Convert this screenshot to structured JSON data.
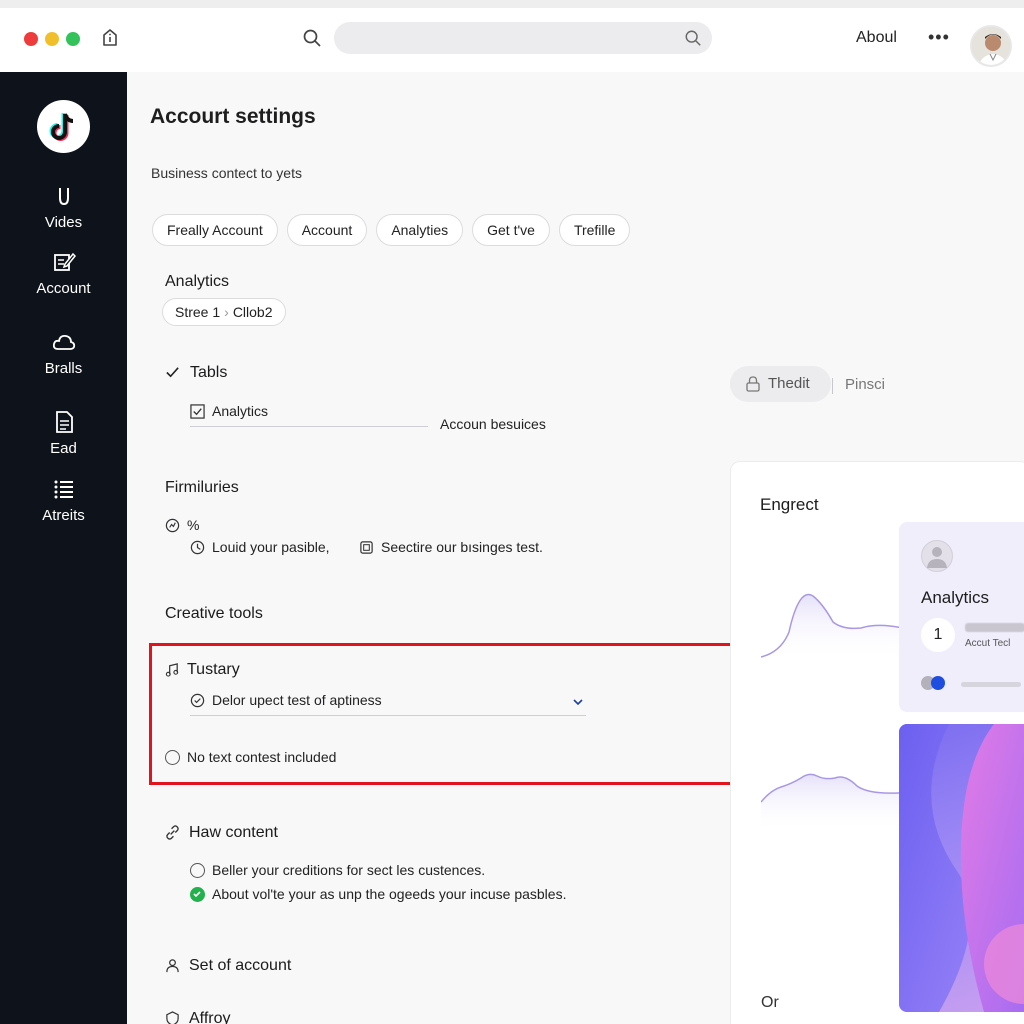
{
  "window": {
    "about_label": "Aboul",
    "search_placeholder": ""
  },
  "sidebar": {
    "items": [
      {
        "label": "Vides",
        "icon": "shield-icon"
      },
      {
        "label": "Account",
        "icon": "edit-icon"
      },
      {
        "label": "Bralls",
        "icon": "cloud-icon"
      },
      {
        "label": "Ead",
        "icon": "document-icon"
      },
      {
        "label": "Atreits",
        "icon": "list-icon"
      }
    ]
  },
  "main": {
    "title": "Accourt settings",
    "subtitle": "Business contect to yets",
    "tabs": [
      "Freally Account",
      "Account",
      "Analyties",
      "Get t've",
      "Trefille"
    ],
    "analytics": {
      "heading": "Analytics",
      "crumb_1": "Stree 1",
      "crumb_2": "Cllob2"
    },
    "tabls": {
      "heading": "Tabls",
      "checkbox_label": "Analytics",
      "side_text": "Accoun besuices"
    },
    "firmiluries": {
      "heading": "Firmiluries",
      "percent": "%",
      "item_1": "Louid your pasible,",
      "item_2": "Seectire our bısinges test."
    },
    "creative_tools": {
      "heading": "Creative tools",
      "tustary_label": "Tustary",
      "dropdown_value": "Delor upect test of aptiness",
      "radio_label": "No text contest included"
    },
    "haw_content": {
      "heading": "Haw content",
      "option_1": "Beller your creditions for sect les custences.",
      "option_2": "About vol'te your as unp the ogeeds your incuse pasbles."
    },
    "set_of_account": "Set of account",
    "affroy": "Affroy"
  },
  "right": {
    "thedit_button": "Thedit",
    "pinsci": "Pinsci",
    "panel_title": "Engrect",
    "panel_footer": "Or",
    "card": {
      "title": "Analytics",
      "number": "1",
      "caption": "Accut Tecl"
    }
  },
  "colors": {
    "sidebar_bg": "#0e131b",
    "highlight_border": "#e0141c",
    "check_green": "#22b14c",
    "accent_blue": "#1f4de0"
  }
}
